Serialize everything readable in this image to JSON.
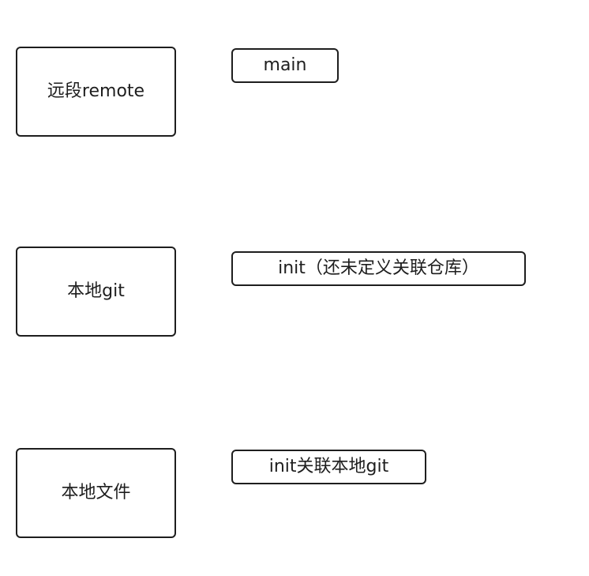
{
  "nodes": [
    {
      "label": "远段remote"
    },
    {
      "label": "本地git"
    },
    {
      "label": "本地文件"
    }
  ],
  "tags": [
    {
      "label": "main"
    },
    {
      "label": "init（还未定义关联仓库）"
    },
    {
      "label": "init关联本地git"
    }
  ]
}
